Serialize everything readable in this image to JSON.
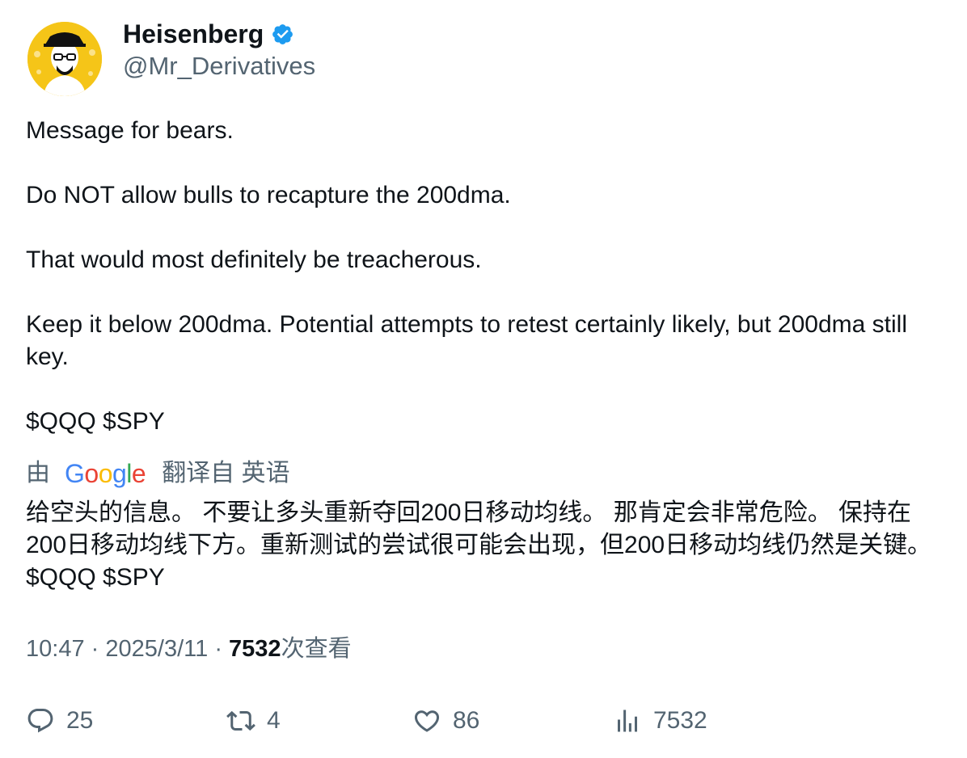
{
  "author": {
    "display_name": "Heisenberg",
    "handle": "@Mr_Derivatives",
    "verified": true
  },
  "tweet": {
    "paragraphs": [
      "Message for bears.",
      "Do NOT allow bulls to recapture the 200dma.",
      "That would most definitely be treacherous.",
      "Keep it below 200dma. Potential attempts to retest certainly likely, but 200dma still key.",
      "$QQQ $SPY"
    ]
  },
  "translation": {
    "prefix": "由",
    "provider": "Google",
    "suffix": "翻译自 英语",
    "text": "给空头的信息。 不要让多头重新夺回200日移动均线。 那肯定会非常危险。 保持在200日移动均线下方。重新测试的尝试很可能会出现，但200日移动均线仍然是关键。 $QQQ $SPY"
  },
  "meta": {
    "time": "10:47",
    "separator": "·",
    "date": "2025/3/11",
    "views_count": "7532",
    "views_label": "次查看"
  },
  "actions": {
    "replies": "25",
    "retweets": "4",
    "likes": "86",
    "views": "7532"
  },
  "colors": {
    "text": "#0f1419",
    "secondary": "#536471",
    "verified": "#1d9bf0",
    "avatar_bg": "#f5c518"
  }
}
